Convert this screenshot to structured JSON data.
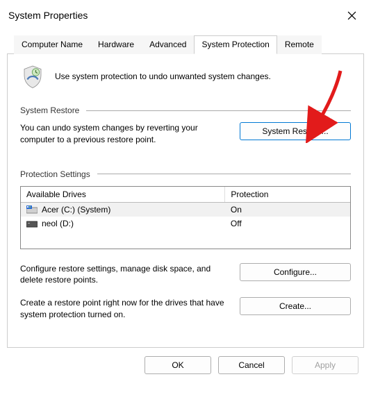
{
  "window": {
    "title": "System Properties"
  },
  "tabs": {
    "t0": "Computer Name",
    "t1": "Hardware",
    "t2": "Advanced",
    "t3": "System Protection",
    "t4": "Remote"
  },
  "intro": "Use system protection to undo unwanted system changes.",
  "restore": {
    "heading": "System Restore",
    "description": "You can undo system changes by reverting your computer to a previous restore point.",
    "button": "System Restore..."
  },
  "protection": {
    "heading": "Protection Settings",
    "col_drive": "Available Drives",
    "col_prot": "Protection",
    "drives": [
      {
        "name": "Acer (C:) (System)",
        "status": "On",
        "type": "system"
      },
      {
        "name": "neol (D:)",
        "status": "Off",
        "type": "data"
      }
    ],
    "configure_text": "Configure restore settings, manage disk space, and delete restore points.",
    "configure_button": "Configure...",
    "create_text": "Create a restore point right now for the drives that have system protection turned on.",
    "create_button": "Create..."
  },
  "footer": {
    "ok": "OK",
    "cancel": "Cancel",
    "apply": "Apply"
  }
}
